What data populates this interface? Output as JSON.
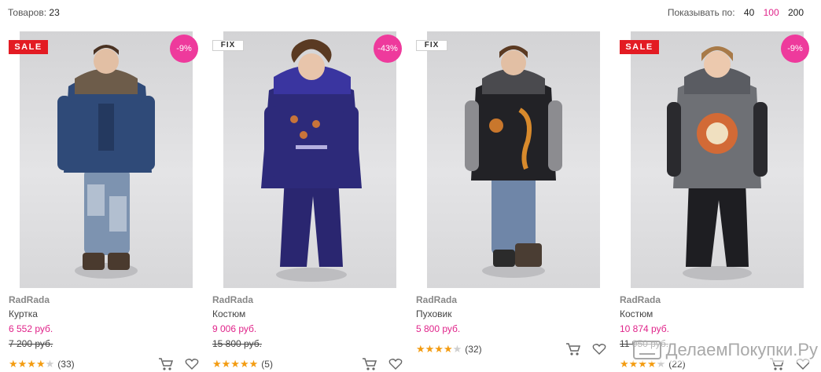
{
  "toolbar": {
    "count_label": "Товаров:",
    "count_value": "23",
    "perpage_label": "Показывать по:",
    "perpage_options": [
      "40",
      "100",
      "200"
    ],
    "perpage_active": "100"
  },
  "colors": {
    "accent": "#e0248a",
    "sale": "#e31b23",
    "discount": "#ee3a9c",
    "star": "#f39c12"
  },
  "products": [
    {
      "badge": "SALE",
      "discount": "-9%",
      "brand": "RadRada",
      "type": "Куртка",
      "price": "6 552 руб.",
      "old_price": "7 200 руб.",
      "rating": 4,
      "reviews": "(33)"
    },
    {
      "badge": "FIX",
      "discount": "-43%",
      "brand": "RadRada",
      "type": "Костюм",
      "price": "9 006 руб.",
      "old_price": "15 800 руб.",
      "rating": 5,
      "reviews": "(5)"
    },
    {
      "badge": "FIX",
      "discount": "",
      "brand": "RadRada",
      "type": "Пуховик",
      "price": "5 800 руб.",
      "old_price": "",
      "rating": 4,
      "reviews": "(32)"
    },
    {
      "badge": "SALE",
      "discount": "-9%",
      "brand": "RadRada",
      "type": "Костюм",
      "price": "10 874 руб.",
      "old_price": "11 950 руб.",
      "rating": 4,
      "reviews": "(22)"
    }
  ],
  "icons": {
    "cart": "cart-icon",
    "wishlist": "heart-icon"
  },
  "watermark": {
    "text": "ДелаемПокупки.Ру"
  }
}
